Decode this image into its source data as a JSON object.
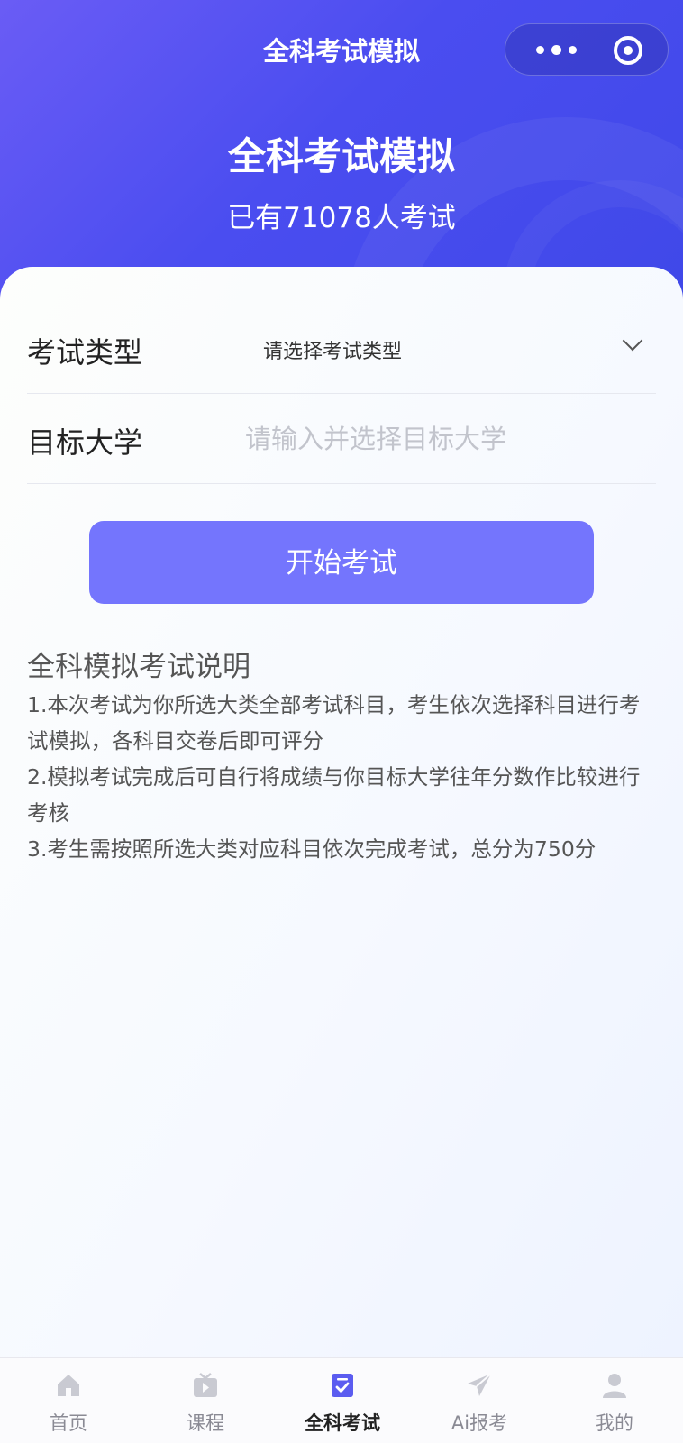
{
  "nav": {
    "title": "全科考试模拟"
  },
  "hero": {
    "title": "全科考试模拟",
    "subtitle": "已有71078人考试"
  },
  "form": {
    "exam_type_label": "考试类型",
    "exam_type_value": "请选择考试类型",
    "target_uni_label": "目标大学",
    "target_uni_placeholder": "请输入并选择目标大学",
    "target_uni_value": "",
    "start_button": "开始考试"
  },
  "instructions": {
    "title": "全科模拟考试说明",
    "items": [
      "1.本次考试为你所选大类全部考试科目，考生依次选择科目进行考试模拟，各科目交卷后即可评分",
      "2.模拟考试完成后可自行将成绩与你目标大学往年分数作比较进行考核",
      "3.考生需按照所选大类对应科目依次完成考试，总分为750分"
    ]
  },
  "tabbar": {
    "items": [
      {
        "label": "首页",
        "icon": "home-icon",
        "active": false
      },
      {
        "label": "课程",
        "icon": "tv-icon",
        "active": false
      },
      {
        "label": "全科考试",
        "icon": "exam-check-icon",
        "active": true
      },
      {
        "label": "Ai报考",
        "icon": "paper-plane-icon",
        "active": false
      },
      {
        "label": "我的",
        "icon": "user-icon",
        "active": false
      }
    ]
  },
  "colors": {
    "hero_start": "#6a5cf5",
    "hero_end": "#3f48e8",
    "button": "#7475fd",
    "active_tab_icon": "#5b5cf0",
    "inactive_tab_icon": "#c9cad2"
  }
}
